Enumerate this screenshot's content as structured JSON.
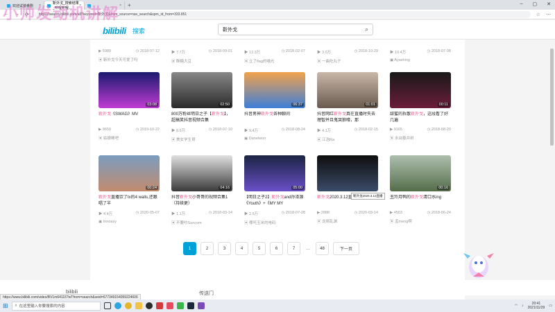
{
  "browser": {
    "tabs": [
      {
        "label": "欢迎试装番剧",
        "active": false
      },
      {
        "label": "靳外戈_搜索结果_哔哩哔哩...",
        "active": true
      },
      {
        "label": "",
        "active": false
      }
    ],
    "url": "https://search.bilibili.com/all?keyword=靳外戈&from_source=nav_search&spm_id_from=333.851"
  },
  "header": {
    "logo": "bilibili",
    "logo_suffix": "搜索",
    "search_value": "靳外戈"
  },
  "top_row": [
    {
      "plays": "5989",
      "date": "2018-07-12",
      "uploader": "靳外戈今天可爱了吗"
    },
    {
      "plays": "7.7万",
      "date": "2018-09-01",
      "uploader": "酥糖大豆"
    },
    {
      "plays": "12.3万",
      "date": "2018-02-07",
      "uploader": "立了flag的喵光"
    },
    {
      "plays": "3.0万",
      "date": "2018-10-29",
      "uploader": "一曲吃丸子"
    },
    {
      "plays": "10.4万",
      "date": "2018-07-08",
      "uploader": "Ayashing"
    }
  ],
  "videos": [
    {
      "title_pre": "",
      "title_hl": "靳外戈",
      "title_post": "《SWAG》MV",
      "duration": "03:08",
      "plays": "9659",
      "date": "2019-10-22",
      "uploader": "姑娘睡吧"
    },
    {
      "title_pre": "800万粉丝明日之子【",
      "title_hl": "靳外戈",
      "title_post": "】，超搞笑抖音视频合集",
      "duration": "02:50",
      "plays": "8.6万",
      "date": "2018-07-10",
      "uploader": "美女学生哥"
    },
    {
      "title_pre": "抖音男神",
      "title_hl": "靳外戈",
      "title_post": "各种聊间",
      "duration": "06:37",
      "plays": "9.4万",
      "date": "2018-08-24",
      "uploader": "Danelwon"
    },
    {
      "title_pre": "抖音网红",
      "title_hl": "靳外戈",
      "title_post": "真在直播时失去理智并且鬼哭狼嚎，那",
      "duration": "01:01",
      "plays": "4.1万",
      "date": "2018-02-15",
      "uploader": "江浩Ra"
    },
    {
      "title_pre": "甜蜜的拆散",
      "title_hl": "靳外戈",
      "title_post": "，这段看了好几遍",
      "duration": "00:11",
      "plays": "9165",
      "date": "2018-08-20",
      "uploader": "水台藤井树"
    },
    {
      "title_pre": "",
      "title_hl": "靳外戈",
      "title_post": "直播饮了tx的4 walls,还跟唱了半",
      "duration": "00:24",
      "plays": "4.4万",
      "date": "2020-05-07",
      "uploader": "Innoasy"
    },
    {
      "title_pre": "抖音",
      "title_hl": "靳外戈",
      "title_post": "小哥哥的视频合集1（持续更）",
      "duration": "04:16",
      "plays": "1.1万",
      "date": "2018-03-14",
      "uploader": "不要吵Suncom"
    },
    {
      "title_pre": "【明日之子2】",
      "title_hl": "靳外戈",
      "title_post": "and孙泽源《Youth》+《MY MY",
      "duration": "05:00",
      "plays": "2.5万",
      "date": "2018-07-28",
      "uploader": "哪吒玉米的电码"
    },
    {
      "title_pre": "",
      "title_hl": "靳外戈",
      "title_post": "2020.3.12直播",
      "duration": "",
      "plays": "2888",
      "date": "2020-03-14",
      "uploader": "龙频乱渊"
    },
    {
      "title_pre": "丑玲月鸭的",
      "title_hl": "靳外戈",
      "title_post": "清口水ing",
      "duration": "00:16",
      "plays": "4563",
      "date": "2018-06-24",
      "uploader": "孟meng啊"
    }
  ],
  "tooltip": "靳外戈2020.3.12直播",
  "pagination": {
    "pages": [
      "1",
      "2",
      "3",
      "4",
      "5",
      "6",
      "7"
    ],
    "current": "1",
    "ellipsis": "...",
    "last": "48",
    "next": "下一页"
  },
  "footer": {
    "left": "bilibili",
    "mid": "传送门"
  },
  "status_url": "https://www.bilibili.com/video/BV1m64115?wTfrom=search&seid=677349154059224606",
  "taskbar": {
    "search_placeholder": "在这里输入你要搜索的内容",
    "time": "20:41",
    "date": "2021/11/29"
  },
  "watermark": "小帅发动机讲解"
}
